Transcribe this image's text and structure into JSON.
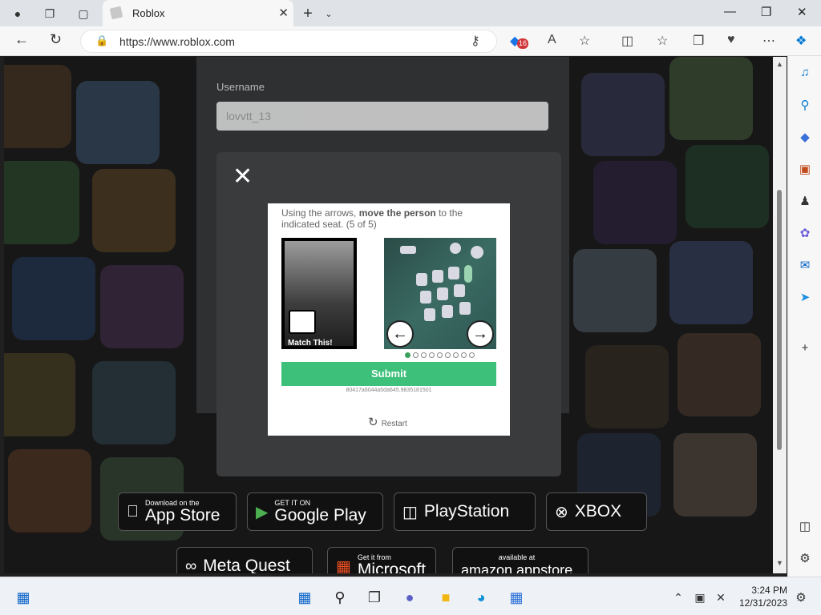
{
  "browser": {
    "tab_title": "Roblox",
    "new_tab_label": "+",
    "url": "https://www.roblox.com",
    "badge_count": "16"
  },
  "login": {
    "username_label": "Username",
    "username_value": "lovvtt_13"
  },
  "captcha": {
    "instruction_prefix": "Using the arrows, ",
    "instruction_bold": "move the person",
    "instruction_suffix": " to the indicated seat. (5 of 5)",
    "match_label": "Match This!",
    "submit_label": "Submit",
    "hash": "80417a6044a5da645.9835181501",
    "restart_label": "Restart",
    "dots_total": 9,
    "dots_active_index": 0
  },
  "stores": [
    {
      "small": "Download on the",
      "big": "App Store"
    },
    {
      "small": "GET IT ON",
      "big": "Google Play"
    },
    {
      "small": "",
      "big": "PlayStation"
    },
    {
      "small": "",
      "big": "XBOX"
    },
    {
      "small": "",
      "big": "Meta Quest"
    },
    {
      "small": "Get it from",
      "big": "Microsoft"
    },
    {
      "small": "available at",
      "big": "amazon appstore"
    }
  ],
  "taskbar": {
    "time": "3:24 PM",
    "date": "12/31/2023"
  },
  "colors": {
    "submit_green": "#3dc07a",
    "edge_blue": "#0078d4",
    "badge_red": "#d13438"
  }
}
